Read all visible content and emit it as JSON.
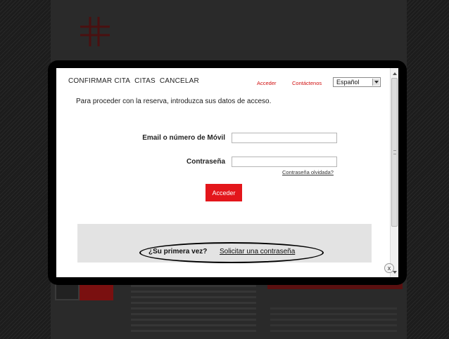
{
  "modal": {
    "tabs": [
      "CONFIRMAR CITA",
      "CITAS",
      "CANCELAR"
    ],
    "acceder_link": "Acceder",
    "contact_link": "Contáctenos",
    "language": "Español",
    "intro": "Para proceder con la reserva, introduzca sus datos de acceso.",
    "email_label": "Email o número de Móvil",
    "email_value": "",
    "password_label": "Contraseña",
    "password_value": "",
    "forgot_link": "Contraseña olvidada?",
    "submit_label": "Acceder",
    "first_time_question": "¿Su primera vez?",
    "request_password_link": "Solicitar una contraseña",
    "close_glyph": "x"
  },
  "colors": {
    "accent_red": "#e3161b",
    "link_red": "#d10f0f",
    "panel_grey": "#e3e3e3"
  },
  "icons": {
    "close": "close-icon",
    "dropdown": "chevron-down-icon"
  }
}
